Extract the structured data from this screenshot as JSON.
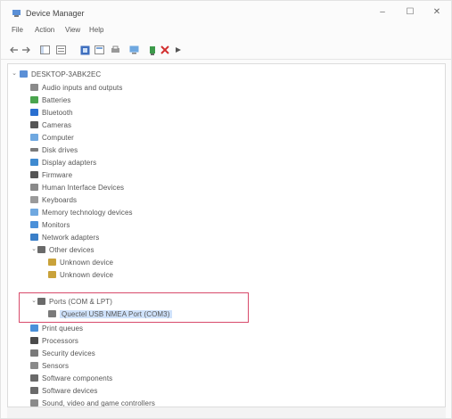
{
  "window": {
    "title": "Device Manager",
    "controls": [
      "–",
      "☐",
      "✕"
    ]
  },
  "menu": [
    "File",
    "Action",
    "View",
    "Help"
  ],
  "tree": {
    "root": "DESKTOP-3ABK2EC",
    "categories": [
      "Audio inputs and outputs",
      "Batteries",
      "Bluetooth",
      "Cameras",
      "Computer",
      "Disk drives",
      "Display adapters",
      "Firmware",
      "Human Interface Devices",
      "Keyboards",
      "Memory technology devices",
      "Monitors",
      "Network adapters",
      "Other devices",
      "Unknown device",
      "Unknown device",
      "Ports (COM & LPT)",
      "Quectel USB NMEA Port (COM3)",
      "Print queues",
      "Processors",
      "Security devices",
      "Sensors",
      "Software components",
      "Software devices",
      "Sound, video and game controllers"
    ]
  },
  "colors": {
    "highlight_border": "#d84a6b",
    "selection": "#cfe2fb"
  }
}
